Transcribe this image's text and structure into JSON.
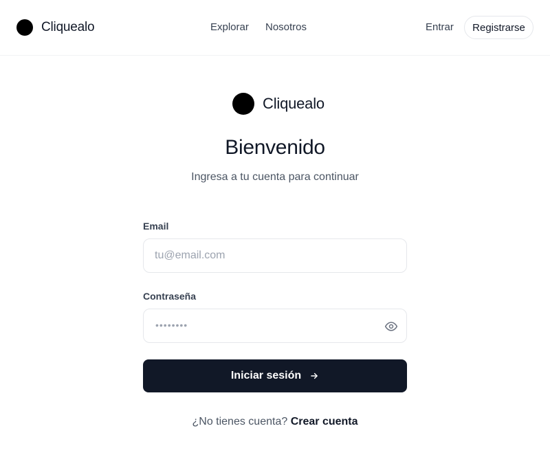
{
  "header": {
    "brand_name": "Cliquealo",
    "nav": {
      "explore": "Explorar",
      "about": "Nosotros"
    },
    "login_label": "Entrar",
    "register_label": "Registrarse"
  },
  "main": {
    "brand_name": "Cliquealo",
    "title": "Bienvenido",
    "subtitle": "Ingresa a tu cuenta para continuar",
    "email": {
      "label": "Email",
      "placeholder": "tu@email.com",
      "value": ""
    },
    "password": {
      "label": "Contraseña",
      "masked_value": "••••••••"
    },
    "submit_label": "Iniciar sesión",
    "signup_prompt": "¿No tienes cuenta?",
    "signup_link": "Crear cuenta"
  },
  "icons": {
    "logo": "logo-circle",
    "password_toggle": "eye-icon",
    "submit_arrow": "arrow-right-icon"
  },
  "colors": {
    "primary": "#111827",
    "text_muted": "#4b5563",
    "border": "#e5e7eb",
    "placeholder": "#9ca3af"
  }
}
